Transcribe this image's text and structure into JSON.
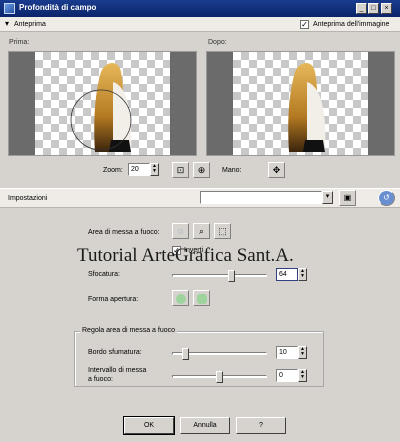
{
  "window": {
    "title": "Profondità di campo",
    "controls": [
      "_",
      "□",
      "×"
    ]
  },
  "preview_header": {
    "toggle_label": "Anteprima",
    "checkbox_label": "Anteprima dell'immagine",
    "checkbox_checked": true
  },
  "before": {
    "label": "Prima:"
  },
  "after": {
    "label": "Dopo:"
  },
  "zoom": {
    "label": "Zoom:",
    "value": "20"
  },
  "hand": {
    "label": "Mano:"
  },
  "settings": {
    "label": "Impostazioni",
    "preset_value": ""
  },
  "focus_area": {
    "label": "Area di messa a fuoco:",
    "invert_label": "Inverti",
    "invert_checked": true
  },
  "blur": {
    "label": "Sfocatura:",
    "value": "64"
  },
  "aperture": {
    "label": "Forma apertura:"
  },
  "focus_group": {
    "title": "Regola area di messa a fuoco",
    "feather": {
      "label": "Bordo sfumatura:",
      "value": "10"
    },
    "range": {
      "label_line1": "Intervallo di messa",
      "label_line2": "a fuoco:",
      "value": "0"
    }
  },
  "buttons": {
    "ok": "OK",
    "cancel": "Annulla",
    "help": "?"
  },
  "watermark": "Tutorial ArteGrafica Sant.A.",
  "colors": {
    "titlebar": "#0a246a",
    "dialog": "#d6d3ce",
    "preview_gray": "#6b6b6b"
  }
}
